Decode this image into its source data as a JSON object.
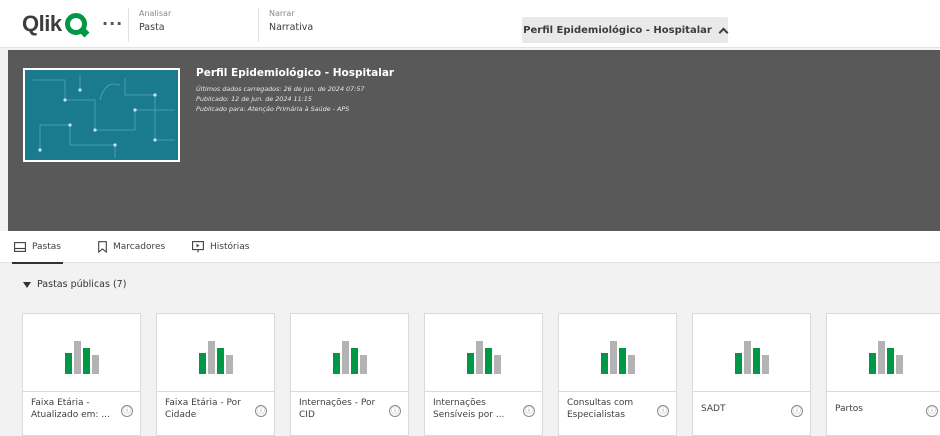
{
  "topbar": {
    "logo": "Qlik",
    "more_label": "···",
    "analisar": {
      "label": "Analisar",
      "value": "Pasta"
    },
    "narrar": {
      "label": "Narrar",
      "value": "Narrativa"
    },
    "app_title": "Perfil Epidemiológico - Hospitalar"
  },
  "hero": {
    "title": "Perfil Epidemiológico - Hospitalar",
    "last_loaded": "Últimos dados carregados: 26 de jun. de 2024 07:57",
    "published": "Publicado: 12 de jun. de 2024 11:15",
    "published_for": "Publicado para: Atenção Primária à Saúde - APS"
  },
  "tabs": [
    {
      "label": "Pastas",
      "icon": "sheet-icon"
    },
    {
      "label": "Marcadores",
      "icon": "bookmark-icon"
    },
    {
      "label": "Histórias",
      "icon": "story-icon"
    }
  ],
  "section": {
    "title": "Pastas públicas (7)"
  },
  "cards": [
    {
      "label_line1": "Faixa Etária -",
      "label_line2": "Atualizado em: ..."
    },
    {
      "label_line1": "Faixa Etária - Por",
      "label_line2": "Cidade"
    },
    {
      "label_line1": "Internações - Por",
      "label_line2": "CID"
    },
    {
      "label_line1": "Internações",
      "label_line2": "Sensíveis por ..."
    },
    {
      "label_line1": "Consultas com",
      "label_line2": "Especialistas"
    },
    {
      "label_line1": "SADT",
      "label_line2": ""
    },
    {
      "label_line1": "Partos",
      "label_line2": ""
    }
  ],
  "colors": {
    "accent_green": "#009845",
    "bar_gray": "#b3b3b3",
    "hero_bg": "#595959",
    "thumb_bg": "#1a7b8f"
  },
  "info_icon": "ⓘ"
}
